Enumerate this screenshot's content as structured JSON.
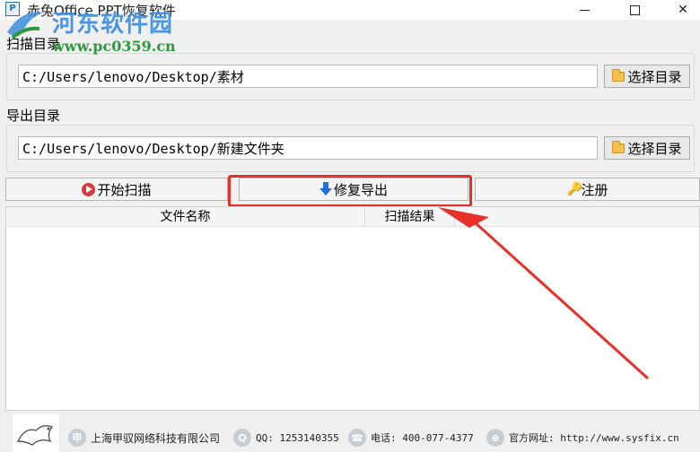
{
  "window": {
    "title": "赤兔Office PPT恢复软件",
    "icon_letter": "P"
  },
  "watermark": {
    "title": "河东软件园",
    "url": "www.pc0359.cn"
  },
  "scan_dir": {
    "label": "扫描目录",
    "path": "C:/Users/lenovo/Desktop/素材",
    "browse_label": "选择目录"
  },
  "export_dir": {
    "label": "导出目录",
    "path": "C:/Users/lenovo/Desktop/新建文件夹",
    "browse_label": "选择目录"
  },
  "actions": {
    "start_label": "开始扫描",
    "export_label": "修复导出",
    "register_label": "注册"
  },
  "table": {
    "columns": [
      "文件名称",
      "扫描结果"
    ]
  },
  "footer": {
    "company": "上海甲驭网络科技有限公司",
    "qq": "QQ: 1253140355",
    "phone": "电话: 400-077-4377",
    "website": "官方网址: http://www.sysfix.cn"
  },
  "colors": {
    "highlight": "#e8302a",
    "accent_blue": "#1e6fd6"
  }
}
